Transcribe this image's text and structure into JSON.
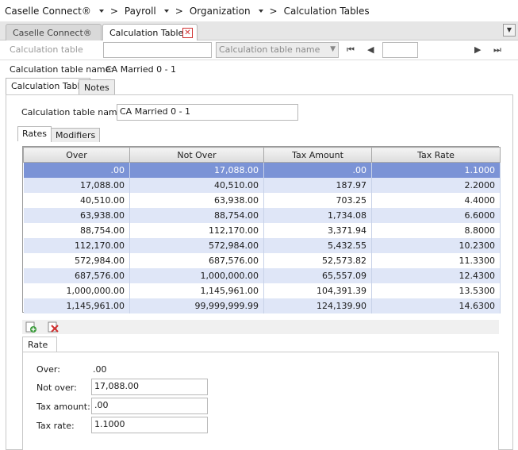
{
  "breadcrumb": {
    "app": "Caselle Connect®",
    "module": "Payroll",
    "section": "Organization",
    "page": "Calculation Tables"
  },
  "tabs": [
    {
      "label": "Caselle Connect®",
      "active": false
    },
    {
      "label": "Calculation Tables",
      "active": true
    }
  ],
  "lookup": {
    "label": "Calculation table",
    "select_value": "Calculation table name"
  },
  "detail": {
    "label": "Calculation table name:",
    "value": "CA Married 0 - 1"
  },
  "sections": {
    "tab_calc": "Calculation Table",
    "tab_notes": "Notes"
  },
  "form": {
    "name_label": "Calculation table name:",
    "name_value": "CA Married 0 - 1"
  },
  "inner_tabs": {
    "rates": "Rates",
    "modifiers": "Modifiers"
  },
  "grid": {
    "columns": [
      "Over",
      "Not Over",
      "Tax Amount",
      "Tax Rate"
    ],
    "rows": [
      [
        ".00",
        "17,088.00",
        ".00",
        "1.1000"
      ],
      [
        "17,088.00",
        "40,510.00",
        "187.97",
        "2.2000"
      ],
      [
        "40,510.00",
        "63,938.00",
        "703.25",
        "4.4000"
      ],
      [
        "63,938.00",
        "88,754.00",
        "1,734.08",
        "6.6000"
      ],
      [
        "88,754.00",
        "112,170.00",
        "3,371.94",
        "8.8000"
      ],
      [
        "112,170.00",
        "572,984.00",
        "5,432.55",
        "10.2300"
      ],
      [
        "572,984.00",
        "687,576.00",
        "52,573.82",
        "11.3300"
      ],
      [
        "687,576.00",
        "1,000,000.00",
        "65,557.09",
        "12.4300"
      ],
      [
        "1,000,000.00",
        "1,145,961.00",
        "104,391.39",
        "13.5300"
      ],
      [
        "1,145,961.00",
        "99,999,999.99",
        "124,139.90",
        "14.6300"
      ]
    ],
    "selected_index": 0
  },
  "rate": {
    "tab_label": "Rate",
    "over_label": "Over:",
    "over_value": ".00",
    "not_over_label": "Not over:",
    "not_over_value": "17,088.00",
    "tax_amount_label": "Tax amount:",
    "tax_amount_value": ".00",
    "tax_rate_label": "Tax rate:",
    "tax_rate_value": "1.1000"
  },
  "colors": {
    "selected_row": "#7b93d6",
    "alt_row": "#dfe6f7",
    "close_red": "#d03030"
  }
}
